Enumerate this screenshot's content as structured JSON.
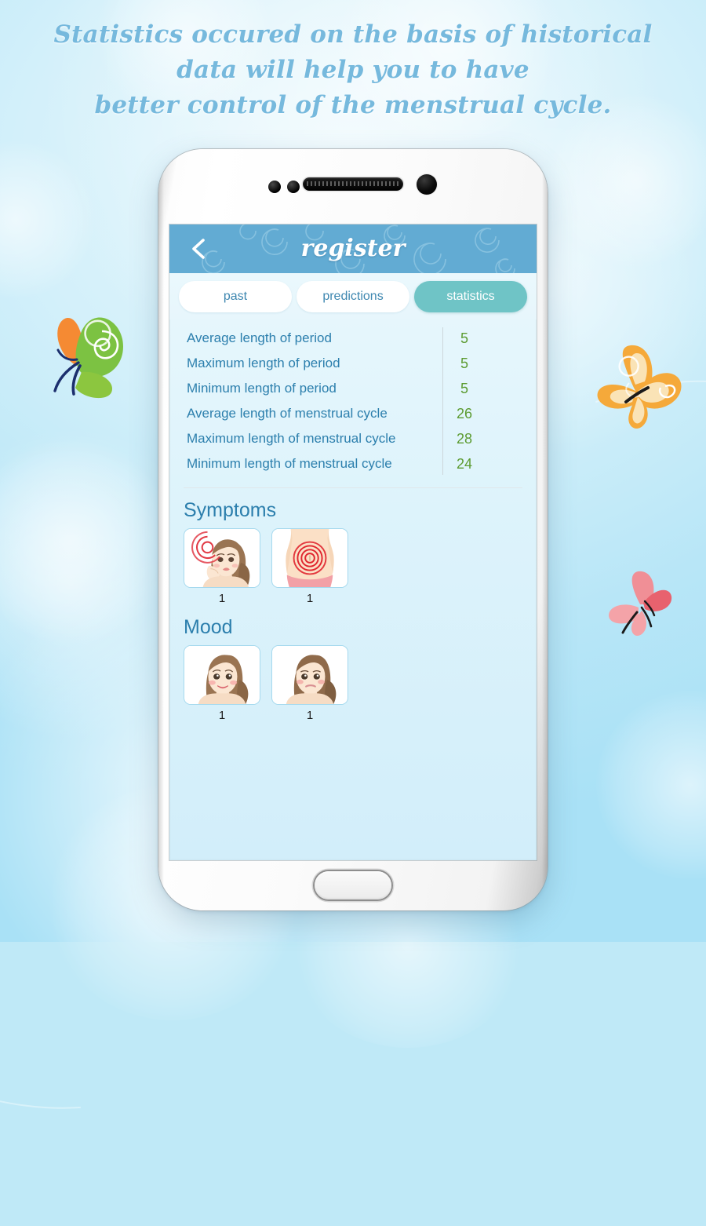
{
  "headline": {
    "line1": "Statistics occured on the basis of historical",
    "line2": "data will help you to have",
    "line3": "better control of the menstrual cycle."
  },
  "app": {
    "header": {
      "title": "register",
      "back_icon": "back-chevron-icon"
    },
    "tabs": [
      {
        "label": "past",
        "active": false
      },
      {
        "label": "predictions",
        "active": false
      },
      {
        "label": "statistics",
        "active": true
      }
    ],
    "statistics": [
      {
        "label": "Average length of period",
        "value": "5"
      },
      {
        "label": "Maximum length of period",
        "value": "5"
      },
      {
        "label": "Minimum length of period",
        "value": "5"
      },
      {
        "label": "Average length of menstrual cycle",
        "value": "26"
      },
      {
        "label": "Maximum length of menstrual cycle",
        "value": "28"
      },
      {
        "label": "Minimum length of menstrual cycle",
        "value": "24"
      }
    ],
    "symptoms": {
      "title": "Symptoms",
      "items": [
        {
          "icon": "headache-icon",
          "count": "1"
        },
        {
          "icon": "abdominal-cramp-icon",
          "count": "1"
        }
      ]
    },
    "mood": {
      "title": "Mood",
      "items": [
        {
          "icon": "happy-face-icon",
          "count": "1"
        },
        {
          "icon": "neutral-face-icon",
          "count": "1"
        }
      ]
    }
  },
  "decorations": {
    "butterflies": [
      {
        "name": "green-orange-butterfly"
      },
      {
        "name": "orange-butterfly"
      },
      {
        "name": "pink-butterfly"
      }
    ]
  },
  "colors": {
    "header_blue": "#62abd3",
    "tab_active_teal": "#6fc4c6",
    "label_blue": "#2c7fad",
    "value_green": "#5c9b31",
    "headline_blue": "#76b9dd",
    "screen_bg": "#e4f5fc"
  }
}
